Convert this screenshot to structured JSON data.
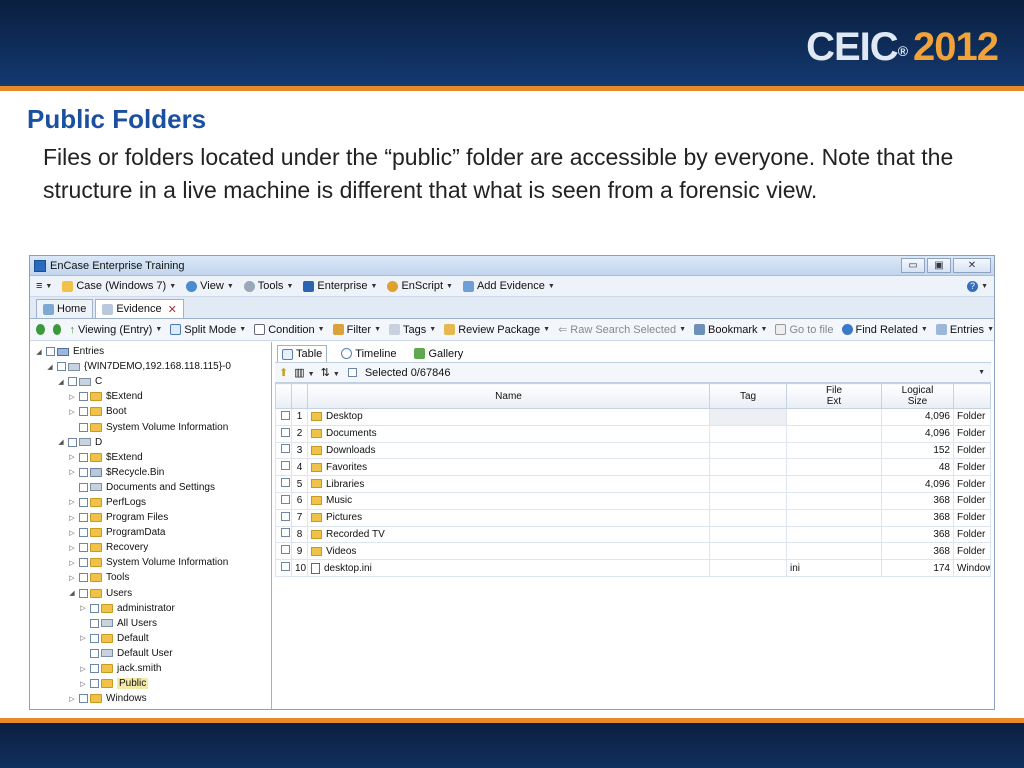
{
  "slide": {
    "logo_main": "CEIC",
    "logo_reg": "®",
    "logo_year": "2012",
    "title": "Public Folders",
    "body": "Files or folders located under the “public” folder are accessible by everyone. Note that the structure in a live machine is different that what is seen from a forensic view.",
    "colors": {
      "header": "#0f2e5c",
      "accent": "#e8892a",
      "title": "#1b4fa0"
    }
  },
  "app": {
    "window_title": "EnCase Enterprise Training",
    "window_buttons": [
      "▭",
      "▣",
      "✕"
    ],
    "menu": {
      "case": "Case (Windows 7)",
      "view": "View",
      "tools": "Tools",
      "enterprise": "Enterprise",
      "enscript": "EnScript",
      "add_evidence": "Add Evidence",
      "help": "?"
    },
    "tabs": {
      "home": "Home",
      "evidence": "Evidence",
      "close": "✕"
    },
    "toolbar": {
      "viewing": "Viewing (Entry)",
      "split_mode": "Split Mode",
      "condition": "Condition",
      "filter": "Filter",
      "tags": "Tags",
      "review_package": "Review Package",
      "raw_search": "Raw Search Selected",
      "bookmark": "Bookmark",
      "go_to_file": "Go to file",
      "find_related": "Find Related",
      "entries": "Entries"
    },
    "tree": [
      {
        "label": "Entries",
        "indent": 0,
        "exp": "◢",
        "icon": "entries"
      },
      {
        "label": "{WIN7DEMO,192.168.118.115}-0",
        "indent": 1,
        "exp": "◢",
        "icon": "drive"
      },
      {
        "label": "C",
        "indent": 2,
        "exp": "◢",
        "icon": "drive"
      },
      {
        "label": "$Extend",
        "indent": 3,
        "exp": "▷",
        "icon": "folder"
      },
      {
        "label": "Boot",
        "indent": 3,
        "exp": "▷",
        "icon": "folder"
      },
      {
        "label": "System Volume Information",
        "indent": 3,
        "exp": "",
        "icon": "folder"
      },
      {
        "label": "D",
        "indent": 2,
        "exp": "◢",
        "icon": "drive"
      },
      {
        "label": "$Extend",
        "indent": 3,
        "exp": "▷",
        "icon": "folder"
      },
      {
        "label": "$Recycle.Bin",
        "indent": 3,
        "exp": "▷",
        "icon": "recycle"
      },
      {
        "label": "Documents and Settings",
        "indent": 3,
        "exp": "",
        "icon": "drive"
      },
      {
        "label": "PerfLogs",
        "indent": 3,
        "exp": "▷",
        "icon": "folder"
      },
      {
        "label": "Program Files",
        "indent": 3,
        "exp": "▷",
        "icon": "folder"
      },
      {
        "label": "ProgramData",
        "indent": 3,
        "exp": "▷",
        "icon": "folder"
      },
      {
        "label": "Recovery",
        "indent": 3,
        "exp": "▷",
        "icon": "folder"
      },
      {
        "label": "System Volume Information",
        "indent": 3,
        "exp": "▷",
        "icon": "folder"
      },
      {
        "label": "Tools",
        "indent": 3,
        "exp": "▷",
        "icon": "folder"
      },
      {
        "label": "Users",
        "indent": 3,
        "exp": "◢",
        "icon": "folder"
      },
      {
        "label": "administrator",
        "indent": 4,
        "exp": "▷",
        "icon": "folder"
      },
      {
        "label": "All Users",
        "indent": 4,
        "exp": "",
        "icon": "drive"
      },
      {
        "label": "Default",
        "indent": 4,
        "exp": "▷",
        "icon": "folder"
      },
      {
        "label": "Default User",
        "indent": 4,
        "exp": "",
        "icon": "drive"
      },
      {
        "label": "jack.smith",
        "indent": 4,
        "exp": "▷",
        "icon": "folder"
      },
      {
        "label": "Public",
        "indent": 4,
        "exp": "▷",
        "icon": "folder",
        "highlight": true
      },
      {
        "label": "Windows",
        "indent": 3,
        "exp": "▷",
        "icon": "folder"
      }
    ],
    "right_tabs": {
      "table": "Table",
      "timeline": "Timeline",
      "gallery": "Gallery"
    },
    "selected": "Selected 0/67846",
    "columns": {
      "name": "Name",
      "tag": "Tag",
      "file_ext_1": "File",
      "file_ext_2": "Ext",
      "logical_1": "Logical",
      "logical_2": "Size"
    },
    "rows": [
      {
        "n": "1",
        "name": "Desktop",
        "ext": "",
        "size": "4,096",
        "type": "Folder",
        "icon": "folder"
      },
      {
        "n": "2",
        "name": "Documents",
        "ext": "",
        "size": "4,096",
        "type": "Folder",
        "icon": "folder"
      },
      {
        "n": "3",
        "name": "Downloads",
        "ext": "",
        "size": "152",
        "type": "Folder",
        "icon": "folder"
      },
      {
        "n": "4",
        "name": "Favorites",
        "ext": "",
        "size": "48",
        "type": "Folder",
        "icon": "folder"
      },
      {
        "n": "5",
        "name": "Libraries",
        "ext": "",
        "size": "4,096",
        "type": "Folder",
        "icon": "folder"
      },
      {
        "n": "6",
        "name": "Music",
        "ext": "",
        "size": "368",
        "type": "Folder",
        "icon": "folder"
      },
      {
        "n": "7",
        "name": "Pictures",
        "ext": "",
        "size": "368",
        "type": "Folder",
        "icon": "folder"
      },
      {
        "n": "8",
        "name": "Recorded TV",
        "ext": "",
        "size": "368",
        "type": "Folder",
        "icon": "folder"
      },
      {
        "n": "9",
        "name": "Videos",
        "ext": "",
        "size": "368",
        "type": "Folder",
        "icon": "folder"
      },
      {
        "n": "10",
        "name": "desktop.ini",
        "ext": "ini",
        "size": "174",
        "type": "Window",
        "icon": "file"
      }
    ]
  }
}
